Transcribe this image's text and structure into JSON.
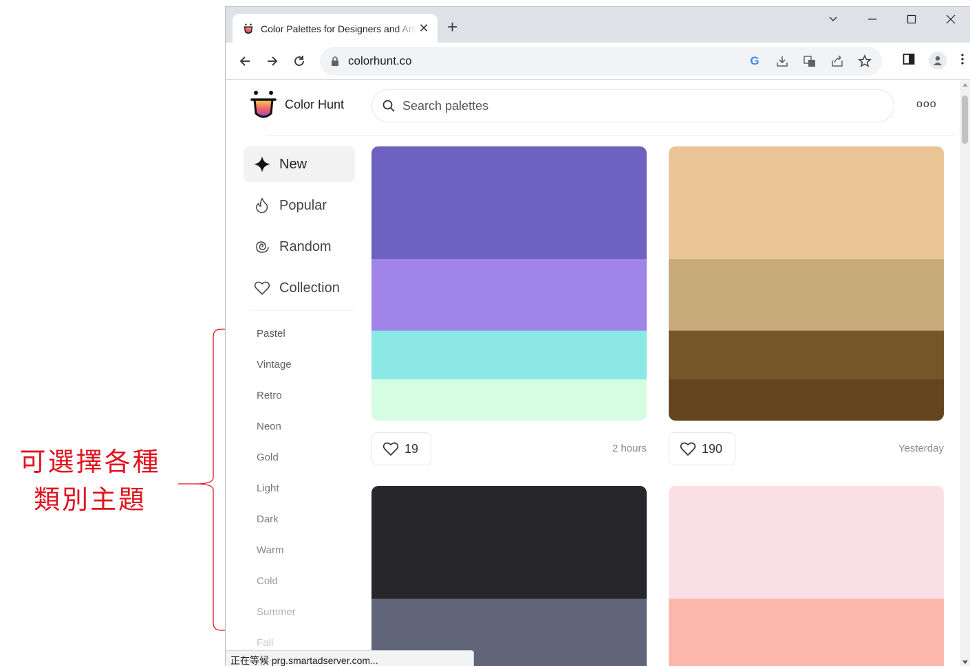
{
  "annotation": {
    "line1": "可選擇各種",
    "line2": "類別主題",
    "color": "#e0141e"
  },
  "browser": {
    "tab_title": "Color Palettes for Designers and Artists - Color Hunt",
    "tab_close": "✕",
    "new_tab": "+",
    "url": "colorhunt.co",
    "status_text": "正在等候 prg.smartadserver.com..."
  },
  "site": {
    "brand": "Color Hunt",
    "search_placeholder": "Search palettes",
    "more": "ooo"
  },
  "sidebar": {
    "items": [
      {
        "label": "New",
        "icon": "sparkle-icon",
        "active": true
      },
      {
        "label": "Popular",
        "icon": "flame-icon",
        "active": false
      },
      {
        "label": "Random",
        "icon": "spiral-icon",
        "active": false
      },
      {
        "label": "Collection",
        "icon": "heart-icon",
        "active": false
      }
    ],
    "tags": [
      "Pastel",
      "Vintage",
      "Retro",
      "Neon",
      "Gold",
      "Light",
      "Dark",
      "Warm",
      "Cold",
      "Summer",
      "Fall"
    ],
    "tag_colors": [
      "#555555",
      "#5f5f5f",
      "#666666",
      "#6c6c6c",
      "#727272",
      "#787878",
      "#7f7f7f",
      "#888888",
      "#9a9a9a",
      "#b0b0b0",
      "#c8c8c8"
    ]
  },
  "palettes": [
    {
      "likes": "19",
      "time": "2 hours",
      "colors": [
        "#6f61c0",
        "#a084e8",
        "#8be8e5",
        "#d5fde1"
      ]
    },
    {
      "likes": "190",
      "time": "Yesterday",
      "colors": [
        "#e8c496",
        "#c7ab7b",
        "#765528",
        "#654520"
      ]
    },
    {
      "likes": "",
      "time": "",
      "colors": [
        "#27272b",
        "#61657a"
      ]
    },
    {
      "likes": "",
      "time": "",
      "colors": [
        "#fae0e4",
        "#fbb8aa"
      ]
    }
  ]
}
